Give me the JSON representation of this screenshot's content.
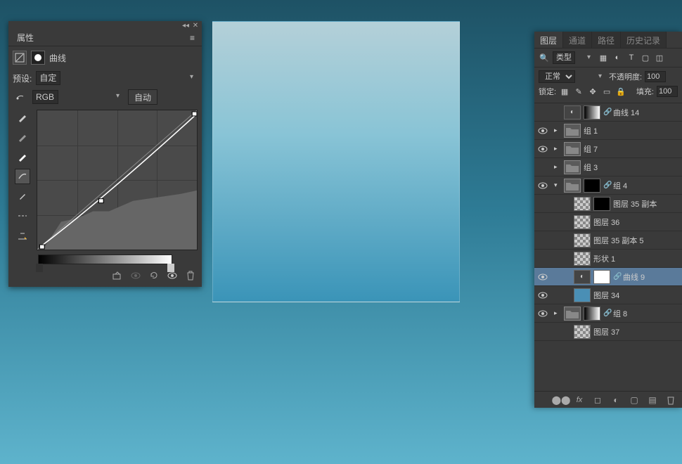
{
  "props": {
    "title": "属性",
    "adjustment_label": "曲线",
    "preset_label": "预设:",
    "preset_value": "自定",
    "channel_value": "RGB",
    "auto_button": "自动"
  },
  "layers": {
    "tabs": [
      "图层",
      "通道",
      "路径",
      "历史记录"
    ],
    "filter_label": "类型",
    "blend_mode": "正常",
    "opacity_label": "不透明度:",
    "opacity_value": "100",
    "lock_label": "锁定:",
    "fill_label": "填充:",
    "fill_value": "100",
    "items": [
      {
        "vis": false,
        "indent": 0,
        "expand": "",
        "thumbs": [
          "adj",
          "grad"
        ],
        "link": true,
        "name": "曲线 14"
      },
      {
        "vis": true,
        "indent": 0,
        "expand": "▸",
        "thumbs": [
          "folder"
        ],
        "link": false,
        "name": "组 1"
      },
      {
        "vis": true,
        "indent": 0,
        "expand": "▸",
        "thumbs": [
          "folder"
        ],
        "link": false,
        "name": "组 7"
      },
      {
        "vis": false,
        "indent": 0,
        "expand": "▸",
        "thumbs": [
          "folder"
        ],
        "link": false,
        "name": "组 3"
      },
      {
        "vis": true,
        "indent": 0,
        "expand": "▾",
        "thumbs": [
          "folder",
          "black"
        ],
        "link": true,
        "name": "组 4"
      },
      {
        "vis": false,
        "indent": 1,
        "expand": "",
        "thumbs": [
          "checker",
          "black"
        ],
        "link": false,
        "name": "图层 35 副本"
      },
      {
        "vis": false,
        "indent": 1,
        "expand": "",
        "thumbs": [
          "checker"
        ],
        "link": false,
        "name": "图层 36"
      },
      {
        "vis": false,
        "indent": 1,
        "expand": "",
        "thumbs": [
          "checker"
        ],
        "link": false,
        "name": "图层 35 副本 5"
      },
      {
        "vis": false,
        "indent": 1,
        "expand": "",
        "thumbs": [
          "checker"
        ],
        "link": false,
        "name": "形状 1",
        "shape": true
      },
      {
        "vis": true,
        "indent": 1,
        "expand": "",
        "thumbs": [
          "adj",
          "white"
        ],
        "link": true,
        "name": "曲线 9",
        "selected": true
      },
      {
        "vis": true,
        "indent": 1,
        "expand": "",
        "thumbs": [
          "blue"
        ],
        "link": false,
        "name": "图层 34"
      },
      {
        "vis": true,
        "indent": 0,
        "expand": "▸",
        "thumbs": [
          "folder",
          "grad"
        ],
        "link": true,
        "name": "组 8"
      },
      {
        "vis": false,
        "indent": 1,
        "expand": "",
        "thumbs": [
          "checker"
        ],
        "link": false,
        "name": "图层 37"
      }
    ]
  }
}
